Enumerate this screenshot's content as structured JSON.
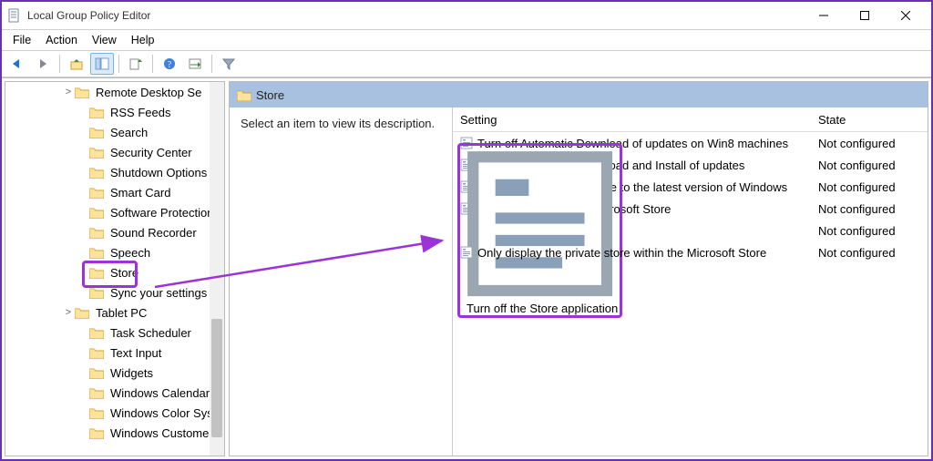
{
  "window": {
    "title": "Local Group Policy Editor"
  },
  "menu": {
    "file": "File",
    "action": "Action",
    "view": "View",
    "help": "Help"
  },
  "tree": {
    "items": [
      {
        "label": "Remote Desktop Se",
        "indent": 1,
        "expander": ">"
      },
      {
        "label": "RSS Feeds",
        "indent": 2,
        "expander": ""
      },
      {
        "label": "Search",
        "indent": 2,
        "expander": ""
      },
      {
        "label": "Security Center",
        "indent": 2,
        "expander": ""
      },
      {
        "label": "Shutdown Options",
        "indent": 2,
        "expander": ""
      },
      {
        "label": "Smart Card",
        "indent": 2,
        "expander": ""
      },
      {
        "label": "Software Protection",
        "indent": 2,
        "expander": ""
      },
      {
        "label": "Sound Recorder",
        "indent": 2,
        "expander": ""
      },
      {
        "label": "Speech",
        "indent": 2,
        "expander": ""
      },
      {
        "label": "Store",
        "indent": 2,
        "expander": "",
        "selected": true
      },
      {
        "label": "Sync your settings",
        "indent": 2,
        "expander": ""
      },
      {
        "label": "Tablet PC",
        "indent": 1,
        "expander": ">"
      },
      {
        "label": "Task Scheduler",
        "indent": 2,
        "expander": ""
      },
      {
        "label": "Text Input",
        "indent": 2,
        "expander": ""
      },
      {
        "label": "Widgets",
        "indent": 2,
        "expander": ""
      },
      {
        "label": "Windows Calendar",
        "indent": 2,
        "expander": ""
      },
      {
        "label": "Windows Color Syst",
        "indent": 2,
        "expander": ""
      },
      {
        "label": "Windows Customer",
        "indent": 2,
        "expander": ""
      }
    ]
  },
  "right": {
    "header": "Store",
    "description": "Select an item to view its description.",
    "columns": {
      "setting": "Setting",
      "state": "State"
    },
    "rows": [
      {
        "setting": "Turn off Automatic Download of updates on Win8 machines",
        "state": "Not configured"
      },
      {
        "setting": "Turn off Automatic Download and Install of updates",
        "state": "Not configured"
      },
      {
        "setting": "Turn off the offer to update to the latest version of Windows",
        "state": "Not configured"
      },
      {
        "setting": "Disable all apps from Microsoft Store",
        "state": "Not configured"
      },
      {
        "setting": "Turn off the Store application",
        "state": "Not configured",
        "highlight": true
      },
      {
        "setting": "Only display the private store within the Microsoft Store",
        "state": "Not configured"
      }
    ]
  },
  "colors": {
    "highlight": "#9b33d6",
    "header": "#a9c1e0"
  }
}
